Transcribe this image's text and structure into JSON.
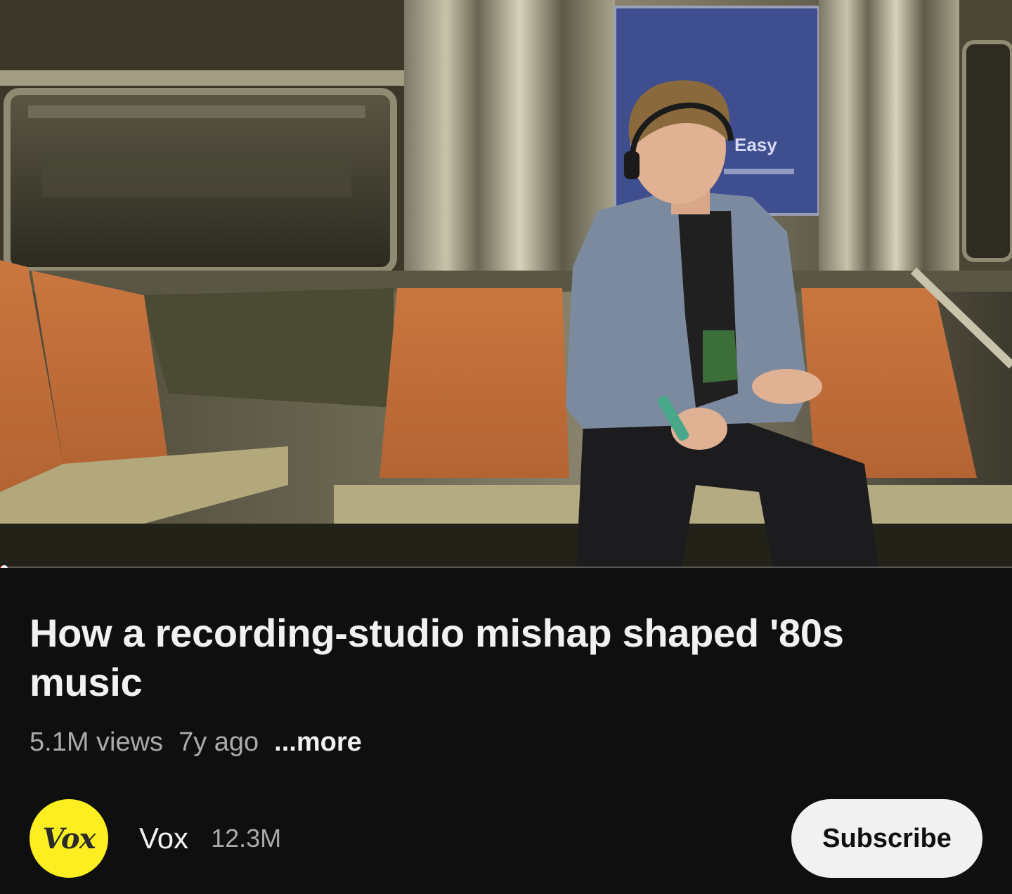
{
  "video": {
    "title": "How a recording-studio mishap shaped '80s music",
    "views": "5.1M views",
    "age": "7y ago",
    "more_label": "...more",
    "progress_fraction": 0.004
  },
  "channel": {
    "avatar_text": "Vox",
    "name": "Vox",
    "subscribers": "12.3M",
    "subscribe_label": "Subscribe"
  },
  "colors": {
    "background": "#0f0f0f",
    "avatar_bg": "#fcee21",
    "subscribe_bg": "#f1f1f1",
    "progress": "#ff0000"
  }
}
